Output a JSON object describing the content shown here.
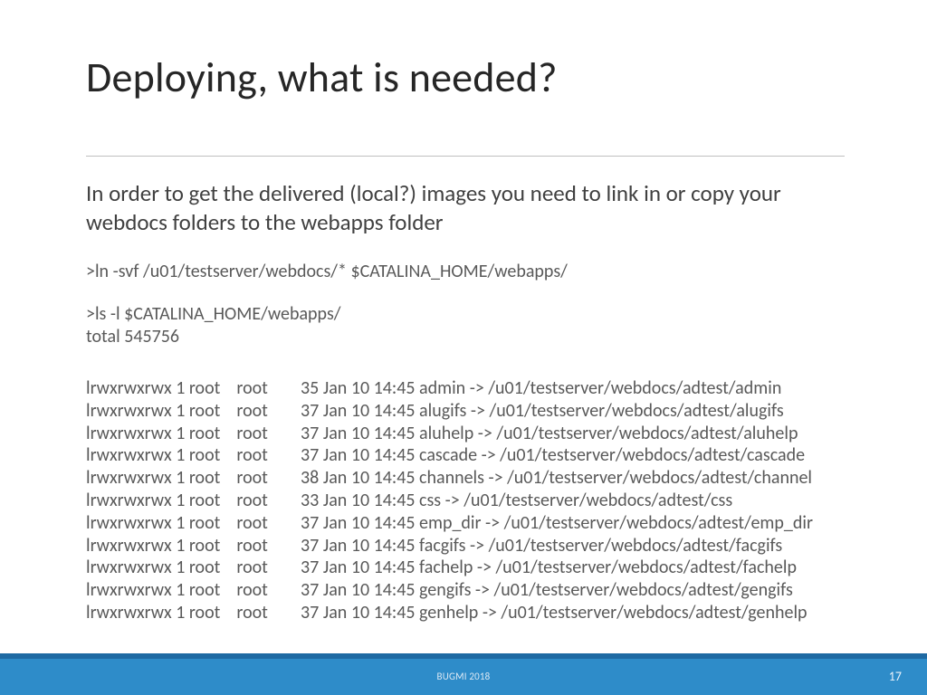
{
  "title": "Deploying, what is needed?",
  "intro": "In order to get the delivered (local?) images you need to link in or copy your webdocs folders to the webapps folder",
  "cmd1": ">ln -svf /u01/testserver/webdocs/* $CATALINA_HOME/webapps/",
  "cmd2": ">ls -l $CATALINA_HOME/webapps/",
  "total": "total 545756",
  "rows": [
    {
      "perm": "lrwxrwxrwx 1 root    root",
      "size": "35",
      "date": "Jan 10 14:45",
      "name": "admin",
      "target": "/u01/testserver/webdocs/adtest/admin"
    },
    {
      "perm": "lrwxrwxrwx 1 root    root",
      "size": "37",
      "date": "Jan 10 14:45",
      "name": "alugifs",
      "target": "/u01/testserver/webdocs/adtest/alugifs"
    },
    {
      "perm": "lrwxrwxrwx 1 root    root",
      "size": "37",
      "date": "Jan 10 14:45",
      "name": "aluhelp",
      "target": "/u01/testserver/webdocs/adtest/aluhelp"
    },
    {
      "perm": "lrwxrwxrwx 1 root    root",
      "size": "37",
      "date": "Jan 10 14:45",
      "name": "cascade",
      "target": "/u01/testserver/webdocs/adtest/cascade"
    },
    {
      "perm": "lrwxrwxrwx 1 root    root",
      "size": "38",
      "date": "Jan 10 14:45",
      "name": "channels",
      "target": "/u01/testserver/webdocs/adtest/channel"
    },
    {
      "perm": "lrwxrwxrwx 1 root    root",
      "size": "33",
      "date": "Jan 10 14:45",
      "name": "css",
      "target": "/u01/testserver/webdocs/adtest/css"
    },
    {
      "perm": "lrwxrwxrwx 1 root    root",
      "size": "37",
      "date": "Jan 10 14:45",
      "name": "emp_dir",
      "target": "/u01/testserver/webdocs/adtest/emp_dir"
    },
    {
      "perm": "lrwxrwxrwx 1 root    root",
      "size": "37",
      "date": "Jan 10 14:45",
      "name": "facgifs",
      "target": "/u01/testserver/webdocs/adtest/facgifs"
    },
    {
      "perm": "lrwxrwxrwx 1 root    root",
      "size": "37",
      "date": "Jan 10 14:45",
      "name": "fachelp",
      "target": "/u01/testserver/webdocs/adtest/fachelp"
    },
    {
      "perm": "lrwxrwxrwx 1 root    root",
      "size": "37",
      "date": "Jan 10 14:45",
      "name": "gengifs",
      "target": "/u01/testserver/webdocs/adtest/gengifs"
    },
    {
      "perm": "lrwxrwxrwx 1 root    root",
      "size": "37",
      "date": "Jan 10 14:45",
      "name": "genhelp",
      "target": "/u01/testserver/webdocs/adtest/genhelp"
    }
  ],
  "footer": {
    "label": "BUGMI 2018",
    "page": "17"
  }
}
